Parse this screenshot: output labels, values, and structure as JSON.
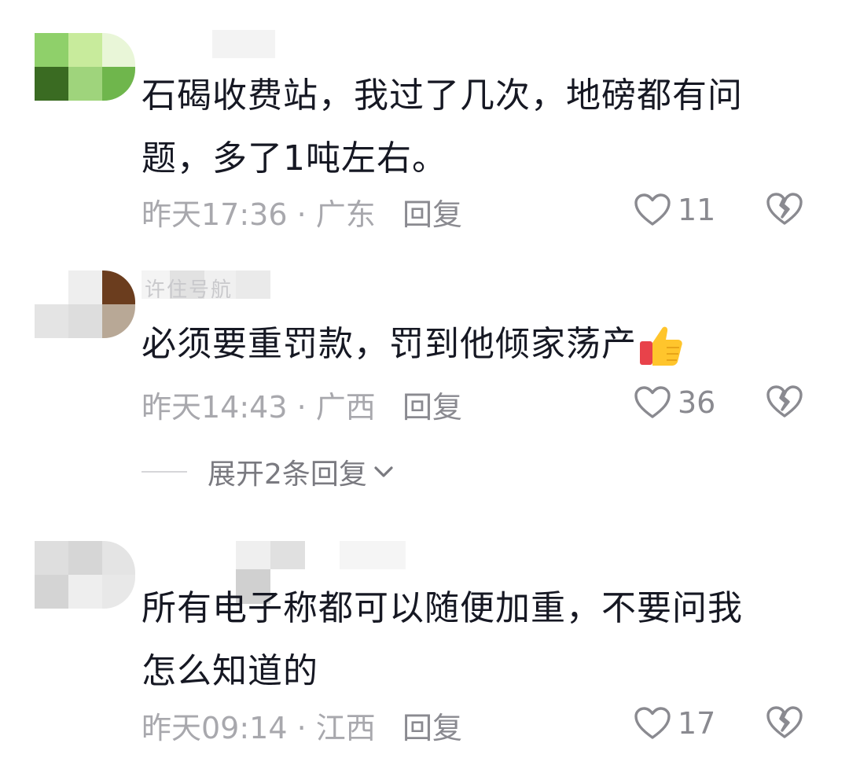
{
  "comments": [
    {
      "text": "石碣收费站，我过了几次，地磅都有问题，多了1吨左右。",
      "time_location": "昨天17:36 · 广东",
      "reply_label": "回复",
      "likes": "11",
      "avatar_colors": [
        "#8fd06a",
        "#c8eb9c",
        "#e9f6d8",
        "#4e8e2e",
        "#3a6b22",
        "#9fd47c"
      ]
    },
    {
      "username": "许住号航",
      "text": "必须要重罚款，罚到他倾家荡产",
      "emoji": "thumbs-up",
      "time_location": "昨天14:43 · 广西",
      "reply_label": "回复",
      "likes": "36",
      "avatar_colors": [
        "#ffffff",
        "#e6e6e6",
        "#6b3d1e",
        "#e4e4e4",
        "#dddddd",
        "#b8a896"
      ],
      "expand_label": "展开2条回复"
    },
    {
      "text": "所有电子称都可以随便加重，不要问我怎么知道的",
      "time_location": "昨天09:14 · 江西",
      "reply_label": "回复",
      "likes": "17",
      "avatar_colors": [
        "#dedede",
        "#dcdcdc",
        "#e4e4e4",
        "#d4d4d4",
        "#eeeeee",
        "#e8e8e8"
      ]
    }
  ],
  "colors": {
    "text": "#161823",
    "meta": "#a8a8ad",
    "icon": "#8a8a90"
  }
}
